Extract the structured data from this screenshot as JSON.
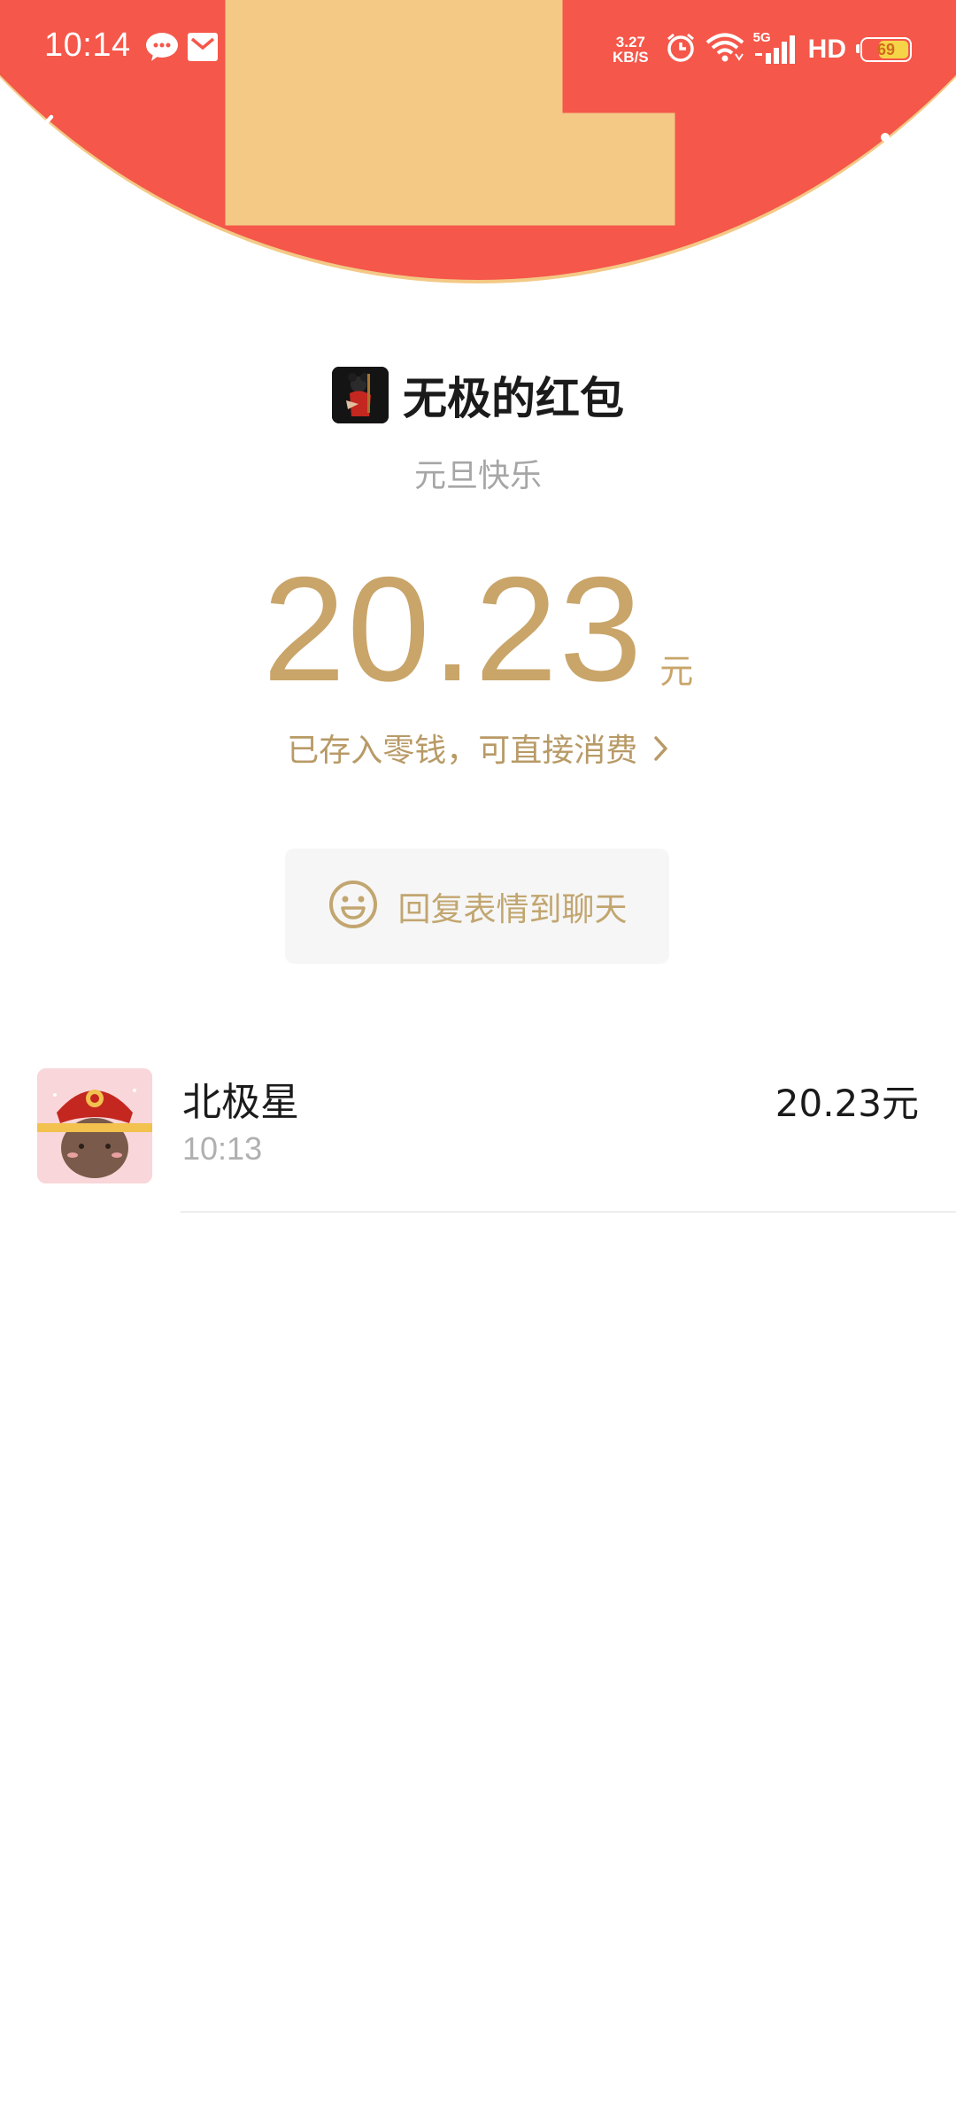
{
  "status_bar": {
    "time": "10:14",
    "notifications": [
      "wechat-icon",
      "mail-icon"
    ],
    "net_speed_value": "3.27",
    "net_speed_unit": "KB/S",
    "network_type": "5G",
    "hd_label": "HD",
    "battery_level": "69",
    "icons": [
      "alarm-icon",
      "wifi-icon",
      "signal-icon",
      "battery-icon"
    ]
  },
  "nav": {
    "back_icon": "chevron-left-icon",
    "more_icon": "more-dots-icon"
  },
  "envelope": {
    "sender_name": "无极的红包",
    "greeting": "元旦快乐",
    "amount": "20.23",
    "amount_unit": "元",
    "stored_text": "已存入零钱，可直接消费",
    "reply_label": "回复表情到聊天"
  },
  "receivers": [
    {
      "name": "北极星",
      "time": "10:13",
      "amount": "20.23元"
    }
  ],
  "colors": {
    "header_red": "#f5574a",
    "header_border": "#f3c985",
    "gold": "#c9a56a"
  }
}
